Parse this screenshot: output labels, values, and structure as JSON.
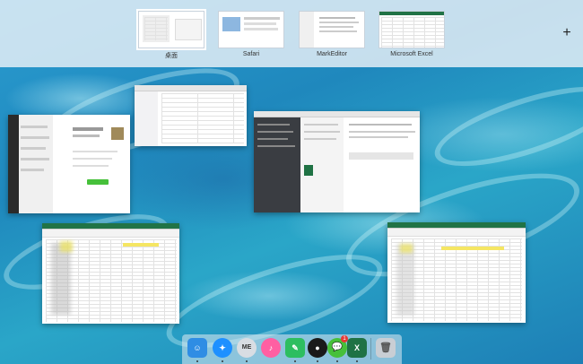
{
  "spaces": [
    {
      "label": "桌面",
      "active": true
    },
    {
      "label": "Safari",
      "active": false
    },
    {
      "label": "MarkEditor",
      "active": false
    },
    {
      "label": "Microsoft Excel",
      "active": false
    }
  ],
  "add_space_symbol": "+",
  "dock": {
    "apps": [
      {
        "name": "finder-icon",
        "glyph": "☺",
        "color": "#2f8de4"
      },
      {
        "name": "safari-icon",
        "glyph": "✦",
        "color": "#1e90ff"
      },
      {
        "name": "markeditor-icon",
        "glyph": "ME",
        "color": "#d8dde3"
      },
      {
        "name": "itunes-icon",
        "glyph": "♪",
        "color": "#ff5fa2"
      },
      {
        "name": "evernote-icon",
        "glyph": "✎",
        "color": "#2dbe60"
      },
      {
        "name": "qq-icon",
        "glyph": "●",
        "color": "#1a1a1a"
      },
      {
        "name": "wechat-icon",
        "glyph": "💬",
        "color": "#46c03a"
      },
      {
        "name": "excel-icon",
        "glyph": "X",
        "color": "#1f7244"
      },
      {
        "name": "trash-icon",
        "glyph": "🗑",
        "color": "#c9ced4"
      }
    ],
    "wechat_badge": "1"
  },
  "colors": {
    "excel_green": "#217346",
    "wechat_green": "#46c03a"
  }
}
